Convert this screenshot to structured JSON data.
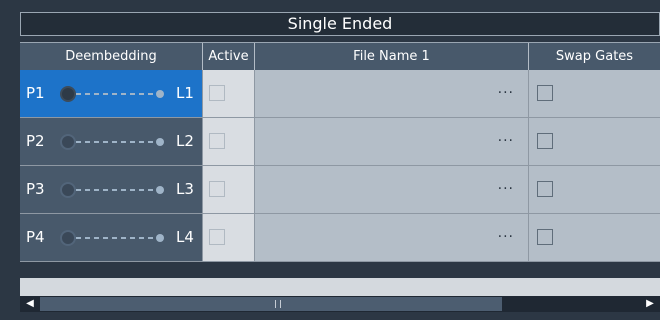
{
  "title": "Single Ended",
  "columns": [
    "Deembedding",
    "Active",
    "File Name 1",
    "Swap Gates"
  ],
  "rows": [
    {
      "port": "P1",
      "link": "L1",
      "selected": true,
      "file_button": "···"
    },
    {
      "port": "P2",
      "link": "L2",
      "selected": false,
      "file_button": "···"
    },
    {
      "port": "P3",
      "link": "L3",
      "selected": false,
      "file_button": "···"
    },
    {
      "port": "P4",
      "link": "L4",
      "selected": false,
      "file_button": "···"
    }
  ],
  "scrollbar": {
    "left": "◀",
    "right": "▶"
  }
}
